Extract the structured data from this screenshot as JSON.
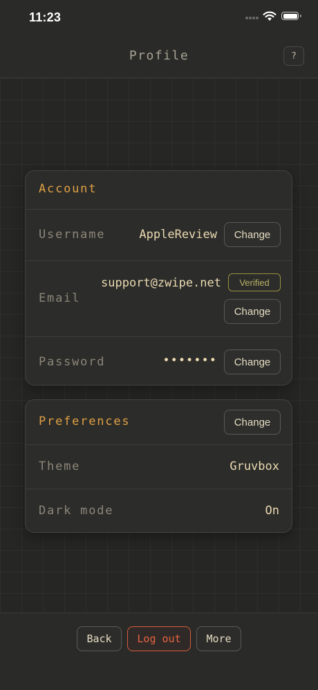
{
  "status_bar": {
    "time": "11:23"
  },
  "header": {
    "title": "Profile",
    "help_label": "?"
  },
  "account": {
    "title": "Account",
    "username": {
      "label": "Username",
      "value": "AppleReview",
      "button": "Change"
    },
    "email": {
      "label": "Email",
      "value": "support@zwipe.net",
      "badge": "Verified",
      "button": "Change"
    },
    "password": {
      "label": "Password",
      "value": "•••••••",
      "button": "Change"
    }
  },
  "preferences": {
    "title": "Preferences",
    "button": "Change",
    "theme": {
      "label": "Theme",
      "value": "Gruvbox"
    },
    "dark_mode": {
      "label": "Dark mode",
      "value": "On"
    }
  },
  "footer": {
    "back": "Back",
    "logout": "Log out",
    "more": "More"
  },
  "colors": {
    "accent": "#e0a144",
    "danger": "#e8633f",
    "verified": "#b9b064",
    "text": "#ebdbb2",
    "muted": "#8d877a"
  }
}
